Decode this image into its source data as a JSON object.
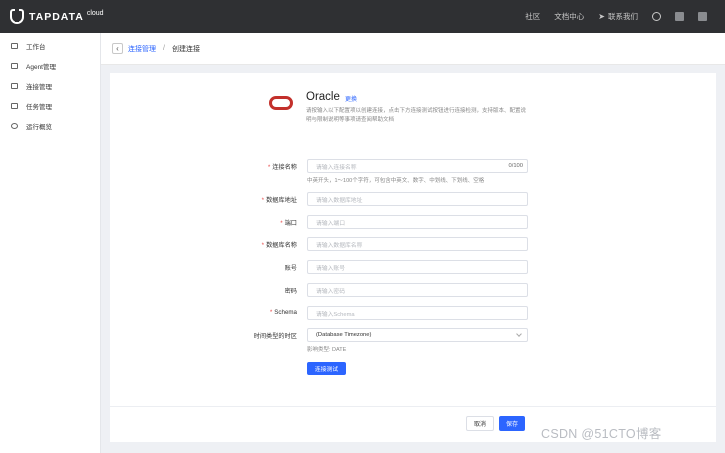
{
  "brand": {
    "name": "TAPDATA",
    "suffix": "cloud"
  },
  "topnav": {
    "community": "社区",
    "docs": "文档中心",
    "contact": "联系我们",
    "icons": [
      "user-icon",
      "app-icon",
      "menu-icon"
    ]
  },
  "sidebar": {
    "items": [
      {
        "label": "工作台",
        "icon": "monitor-icon"
      },
      {
        "label": "Agent管理",
        "icon": "agent-icon"
      },
      {
        "label": "连接管理",
        "icon": "connection-icon"
      },
      {
        "label": "任务管理",
        "icon": "task-icon"
      },
      {
        "label": "运行概览",
        "icon": "clock-icon"
      }
    ]
  },
  "breadcrumb": {
    "parent": "连接管理",
    "separator": "/",
    "current": "创建连接"
  },
  "datasource": {
    "name": "Oracle",
    "change_label": "更换",
    "description": "请按输入以下配置项以创建连接，点击下方连接测试按钮进行连接检测，支持版本、配置说明与限制说明等事项请查阅帮助文档"
  },
  "form": {
    "fields": [
      {
        "label": "连接名称",
        "required": true,
        "placeholder": "请输入连接名称",
        "counter": "0/100",
        "hint": "中英开头，1～100个字符，可包含中英文、数字、中划线、下划线、空格"
      },
      {
        "label": "数据库地址",
        "required": true,
        "placeholder": "请输入数据库地址"
      },
      {
        "label": "端口",
        "required": true,
        "placeholder": "请输入端口"
      },
      {
        "label": "数据库名称",
        "required": true,
        "placeholder": "请输入数据库名称"
      },
      {
        "label": "账号",
        "required": false,
        "placeholder": "请输入账号"
      },
      {
        "label": "密码",
        "required": false,
        "placeholder": "请输入密码"
      },
      {
        "label": "Schema",
        "required": true,
        "placeholder": "请输入Schema"
      }
    ],
    "timezone": {
      "label": "时间类型的时区",
      "value": "(Database Timezone)",
      "hint": "影响类型: DATE"
    },
    "test_button": "连接测试"
  },
  "footer": {
    "cancel": "取消",
    "save": "保存"
  },
  "watermark": "CSDN @51CTO博客",
  "colors": {
    "accent": "#2c65ff",
    "topbar": "#2f3033",
    "oracle": "#c3302b",
    "required": "#e84a4a"
  }
}
